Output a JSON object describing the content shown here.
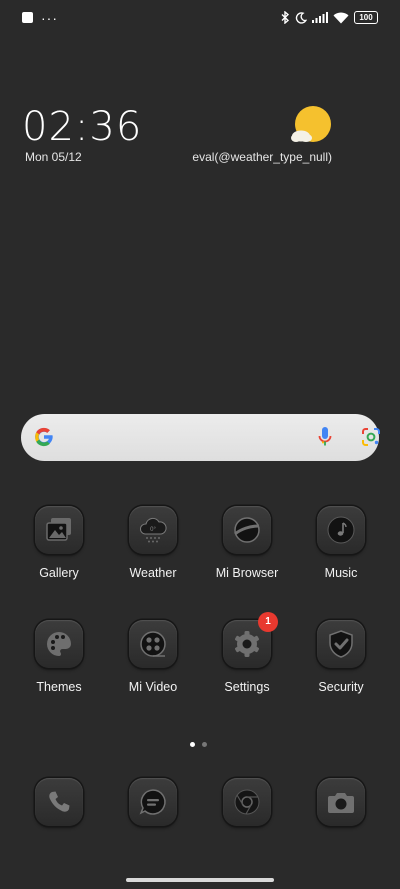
{
  "status_bar": {
    "battery": "100",
    "icons": [
      "notification-square-icon",
      "more-dots-icon",
      "bluetooth-icon",
      "moon-icon",
      "signal-icon",
      "wifi-icon",
      "battery-icon"
    ]
  },
  "clock": {
    "time": "02:36",
    "date": "Mon 05/12"
  },
  "weather": {
    "text": "eval(@weather_type_null)",
    "icon": "sun-cloud-icon",
    "sun_color": "#f5c12e"
  },
  "search_bar": {
    "icons": [
      "google-g-icon",
      "microphone-icon",
      "google-lens-icon"
    ]
  },
  "apps": [
    {
      "label": "Gallery",
      "icon": "gallery-icon"
    },
    {
      "label": "Weather",
      "icon": "weather-cloud-icon",
      "icon_text": "0°"
    },
    {
      "label": "Mi Browser",
      "icon": "planet-icon"
    },
    {
      "label": "Music",
      "icon": "music-note-icon"
    },
    {
      "label": "Themes",
      "icon": "palette-icon"
    },
    {
      "label": "Mi Video",
      "icon": "film-reel-icon"
    },
    {
      "label": "Settings",
      "icon": "gear-icon",
      "badge": "1"
    },
    {
      "label": "Security",
      "icon": "shield-check-icon"
    }
  ],
  "page_indicator": {
    "pages": 2,
    "current": 1
  },
  "dock": [
    {
      "icon": "phone-icon"
    },
    {
      "icon": "messages-icon"
    },
    {
      "icon": "chrome-icon"
    },
    {
      "icon": "camera-icon"
    }
  ],
  "colors": {
    "background": "#2a2a2a",
    "badge": "#e8392f",
    "search_bar": "#e6e6e6"
  }
}
